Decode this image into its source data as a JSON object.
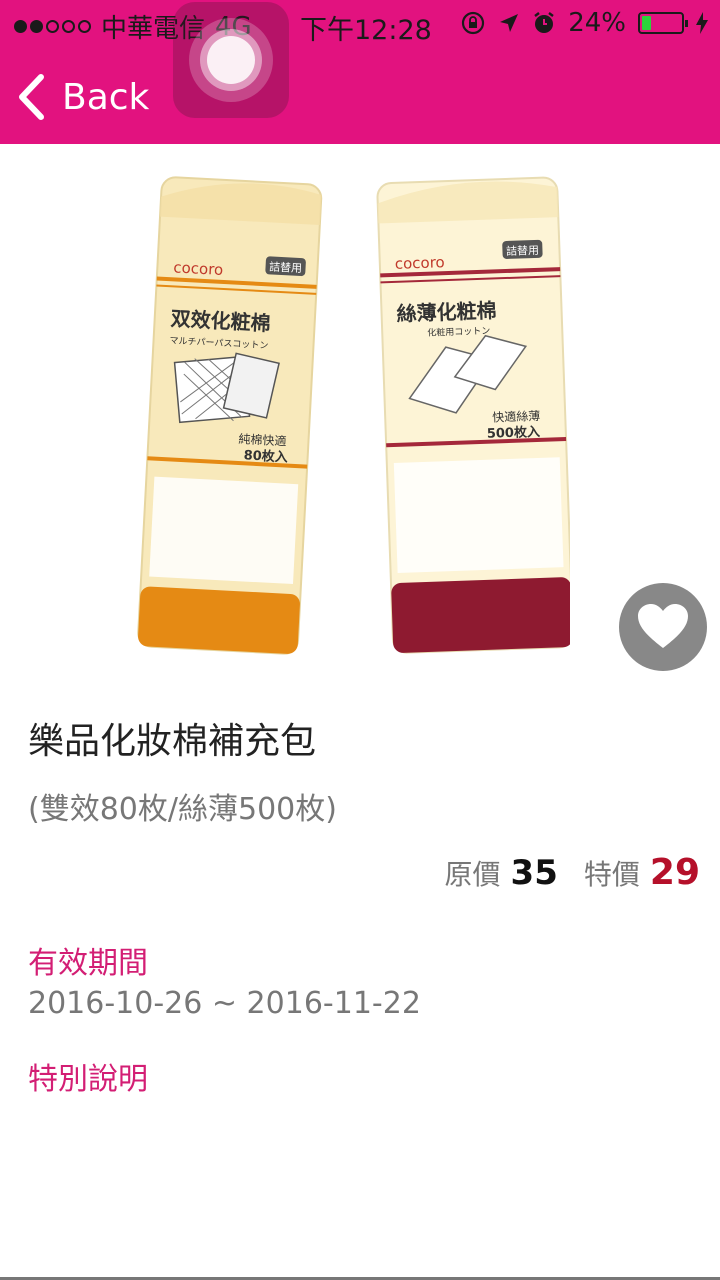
{
  "status_bar": {
    "carrier": "中華電信",
    "network": "4G",
    "time": "下午12:28",
    "battery_percent": "24%",
    "battery_level": 0.24,
    "signal_strength": 2,
    "signal_max": 5
  },
  "nav": {
    "back_label": "Back",
    "accent_color": "#e2127f"
  },
  "product": {
    "title": "樂品化妝棉補充包",
    "subtitle": "(雙效80枚/絲薄500枚)",
    "original_price_label": "原價",
    "original_price": "35",
    "sale_price_label": "特價",
    "sale_price": "29",
    "sale_color": "#b5102a"
  },
  "product_image": {
    "left_pack": {
      "brand": "cocoro",
      "tag": "詰替用",
      "name": "双效化粧棉",
      "name_sub": "マルチパーパスコットン",
      "feature_line1": "純棉快適",
      "feature_line2": "80枚入",
      "band_color": "#e58a14"
    },
    "right_pack": {
      "brand": "cocoro",
      "tag": "詰替用",
      "name": "絲薄化粧棉",
      "name_sub": "化粧用コットン",
      "feature_line1": "快適絲薄",
      "feature_line2": "500枚入",
      "band_color": "#8e1a30"
    }
  },
  "validity": {
    "heading": "有效期間",
    "dates": "2016-10-26 ~ 2016-11-22"
  },
  "notes": {
    "heading": "特別說明"
  },
  "icons": {
    "back": "chevron-left-icon",
    "favorite": "heart-icon",
    "assistive_touch": "assistive-touch-icon"
  }
}
